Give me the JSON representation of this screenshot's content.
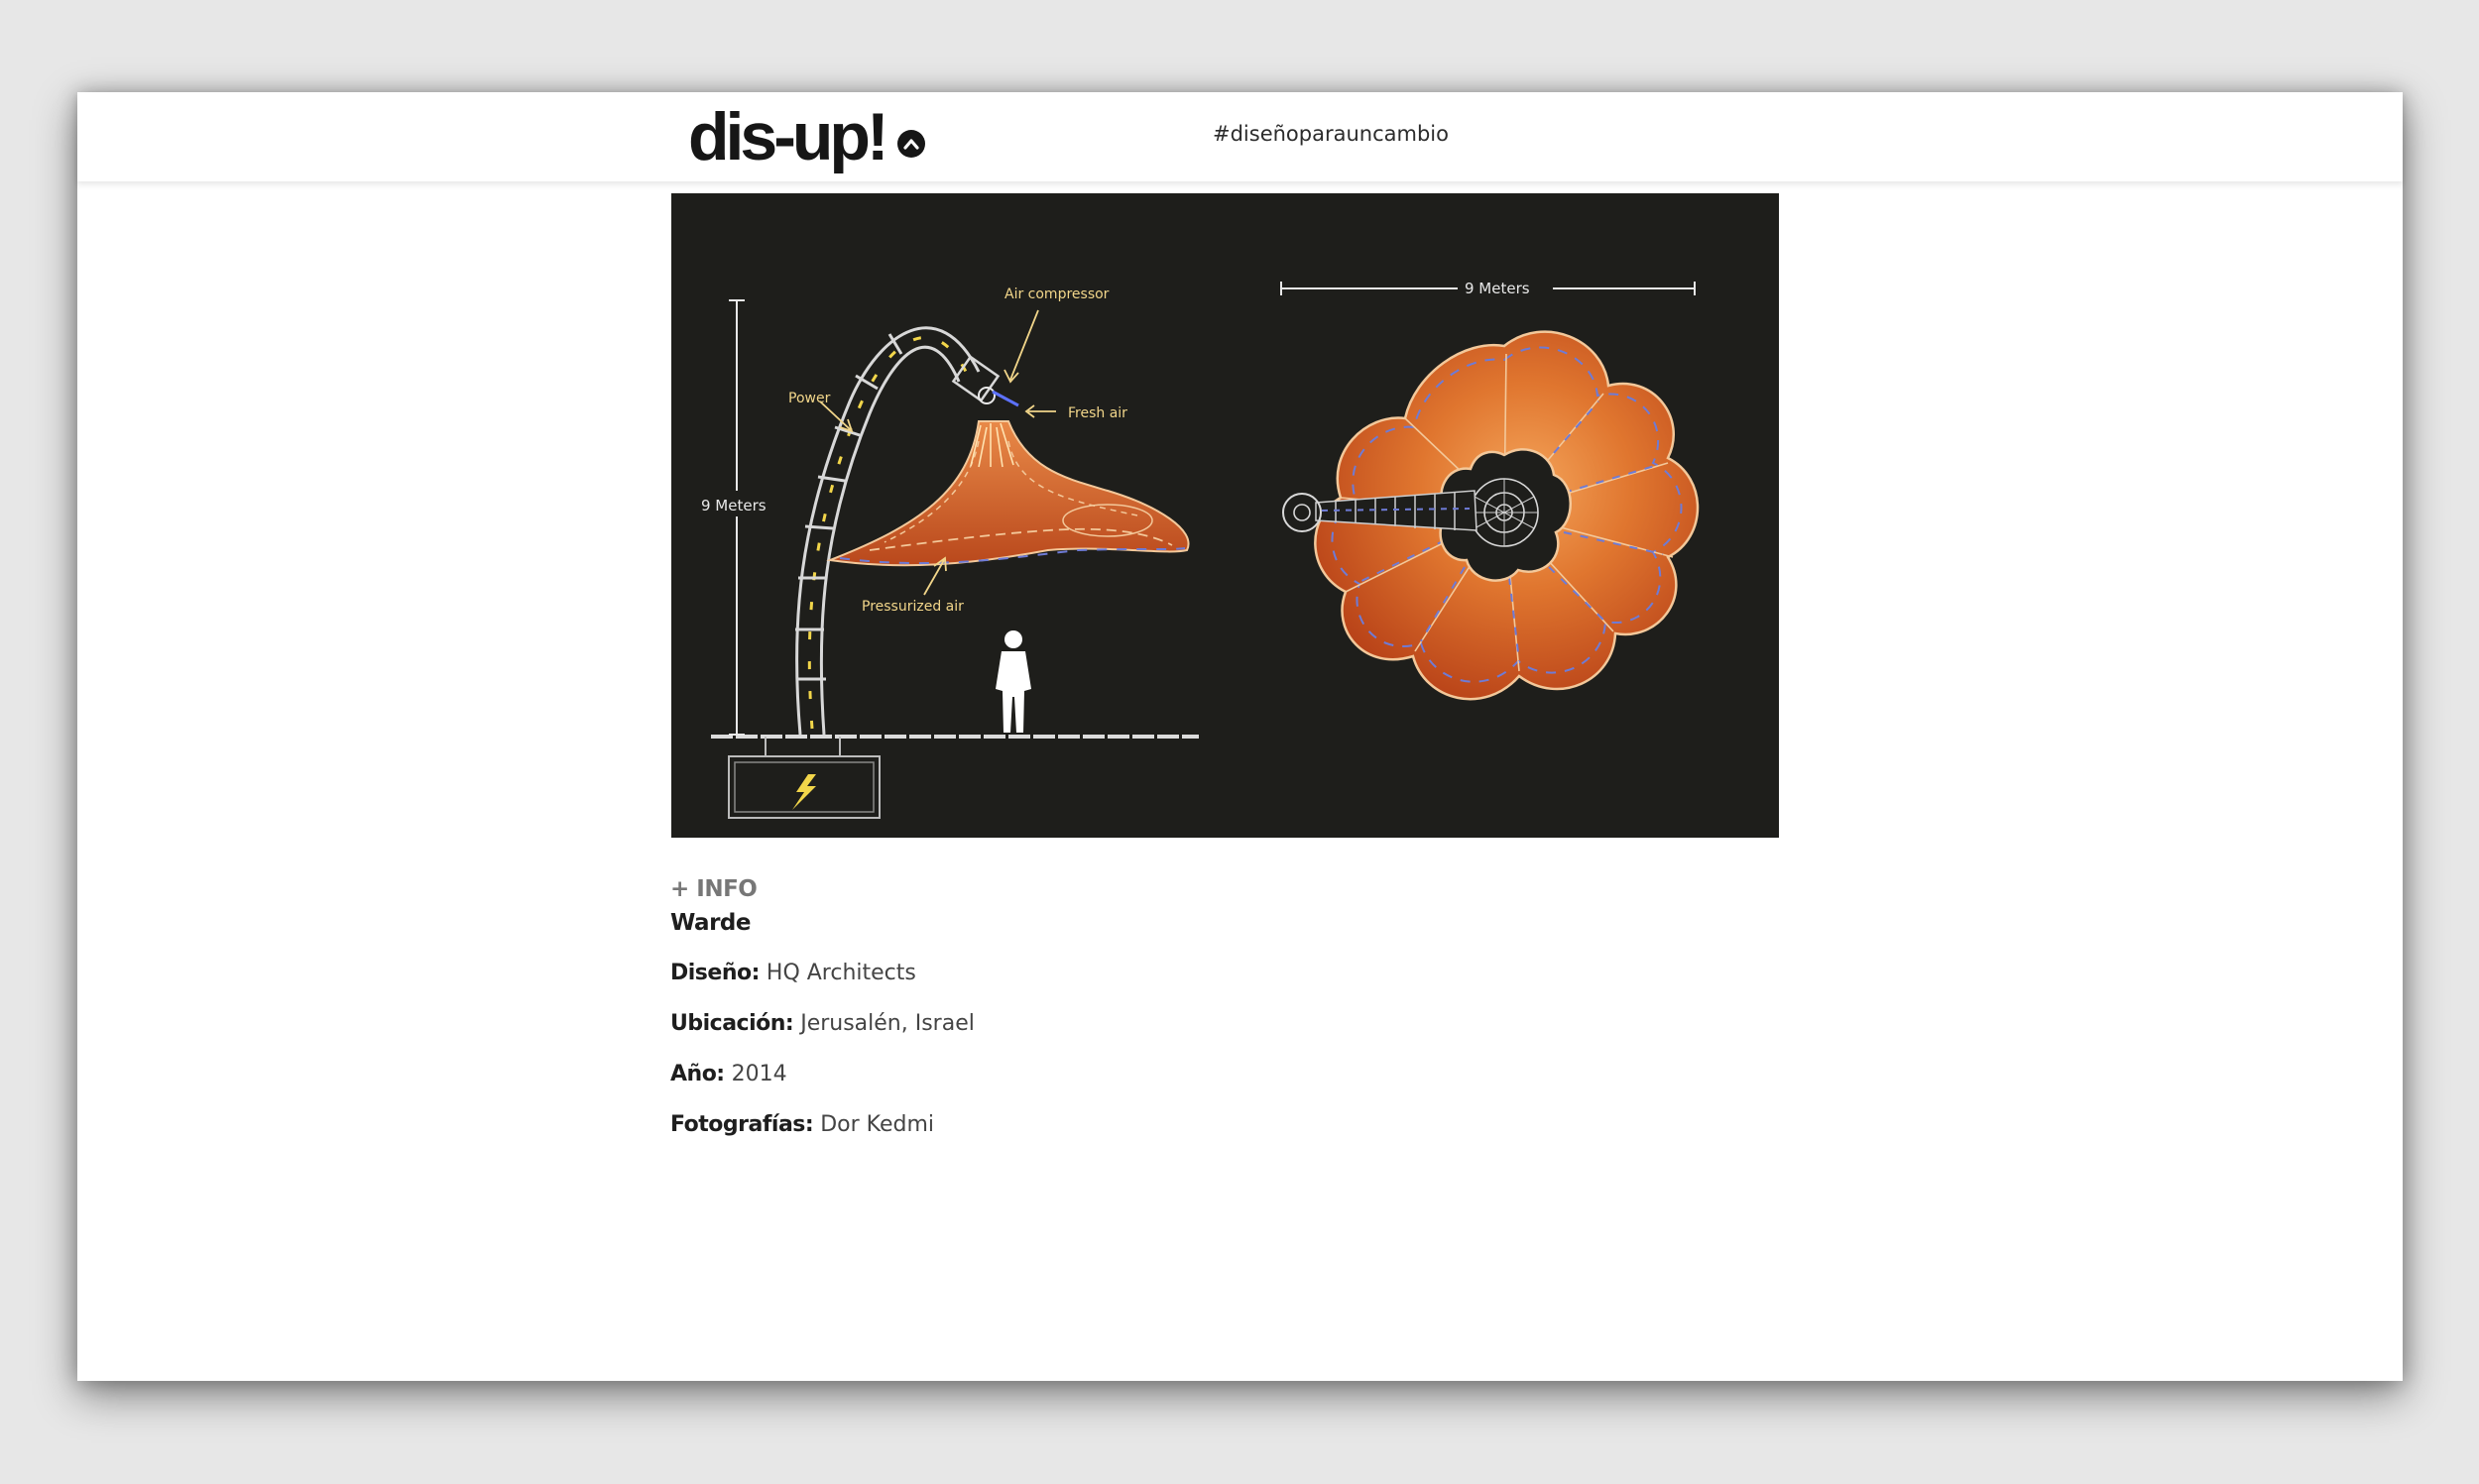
{
  "header": {
    "logo_text": "dis-up!",
    "hashtag": "#diseñoparauncambio"
  },
  "diagram": {
    "labels": {
      "air_compressor": "Air compressor",
      "fresh_air": "Fresh air",
      "power": "Power",
      "height": "9 Meters",
      "pressurized_air": "Pressurized air",
      "width": "9 Meters"
    },
    "colors": {
      "background": "#1e1e1b",
      "canopy": "#c8501f",
      "canopy_light": "#f08a45",
      "annotation": "#f2d68a",
      "lines": "#e8e8e8"
    }
  },
  "info": {
    "toggle": "+ INFO",
    "title": "Warde",
    "rows": [
      {
        "label": "Diseño:",
        "value": "HQ Architects"
      },
      {
        "label": "Ubicación:",
        "value": "Jerusalén, Israel"
      },
      {
        "label": "Año:",
        "value": "2014"
      },
      {
        "label": "Fotografías:",
        "value": "Dor Kedmi"
      }
    ]
  }
}
